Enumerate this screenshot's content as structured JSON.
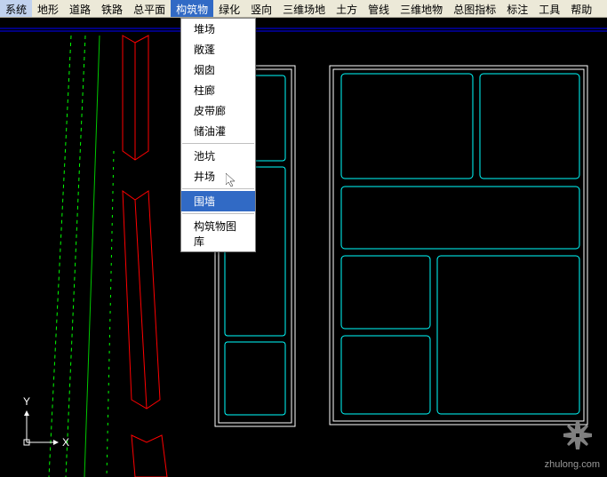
{
  "menubar": {
    "items": [
      "系统",
      "地形",
      "道路",
      "铁路",
      "总平面",
      "构筑物",
      "绿化",
      "竖向",
      "三维场地",
      "土方",
      "管线",
      "三维地物",
      "总图指标",
      "标注",
      "工具",
      "帮助"
    ],
    "active_index": 5
  },
  "dropdown": {
    "groups": [
      [
        "堆场",
        "敞蓬",
        "烟囱",
        "柱廊",
        "皮带廊",
        "储油灌"
      ],
      [
        "池坑",
        "井场"
      ],
      [
        "围墙"
      ],
      [
        "构筑物图库"
      ]
    ],
    "highlighted": "围墙"
  },
  "canvas": {
    "axis_x_label": "X",
    "axis_y_label": "Y"
  },
  "watermark": {
    "text": "zhulong.com"
  }
}
